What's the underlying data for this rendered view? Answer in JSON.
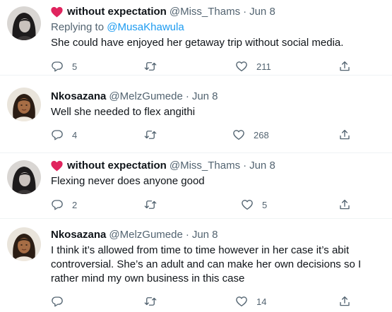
{
  "tweets": [
    {
      "name": "without expectation",
      "handle": "@Miss_Thams",
      "date": "Jun 8",
      "heart_color": "#e0245e",
      "replying_prefix": "Replying to ",
      "replying_to": "@MusaKhawula",
      "text": "She could have enjoyed her getaway trip without social media.",
      "reply_count": "5",
      "retweet_count": "",
      "like_count": "211"
    },
    {
      "name": "Nkosazana",
      "handle": "@MelzGumede",
      "date": "Jun 8",
      "text": "Well she needed to flex angithi",
      "reply_count": "4",
      "retweet_count": "",
      "like_count": "268"
    },
    {
      "name": "without expectation",
      "handle": "@Miss_Thams",
      "date": "Jun 8",
      "heart_color": "#e0245e",
      "text": "Flexing never does anyone good",
      "reply_count": "2",
      "retweet_count": "",
      "like_count": "5"
    },
    {
      "name": "Nkosazana",
      "handle": "@MelzGumede",
      "date": "Jun 8",
      "text": "I think it’s allowed from time to time however in her case it’s abit controversial. She’s an adult and can make her own decisions so I rather mind my own business in this case",
      "reply_count": "",
      "retweet_count": "",
      "like_count": "14"
    }
  ],
  "icons": {
    "reply": "reply-icon",
    "retweet": "retweet-icon",
    "like": "like-icon",
    "share": "share-icon",
    "heart_emoji": "heart-emoji-icon"
  },
  "colors": {
    "text_primary": "#0f1419",
    "text_secondary": "#536471",
    "link": "#1d9bf0",
    "separator": "#eff3f4"
  }
}
